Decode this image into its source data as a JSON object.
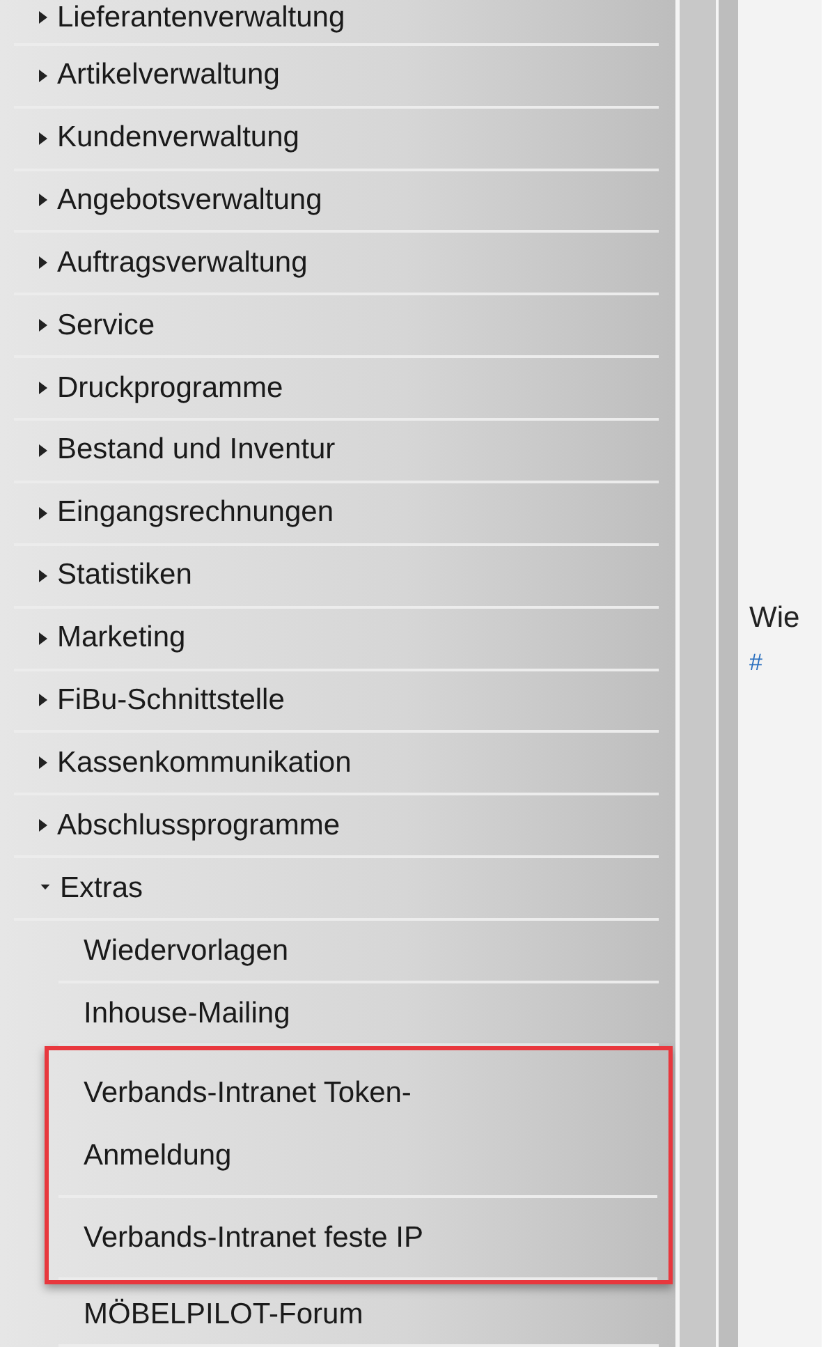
{
  "menu": {
    "items": [
      {
        "label": "Lieferantenverwaltung",
        "expanded": false
      },
      {
        "label": "Artikelverwaltung",
        "expanded": false
      },
      {
        "label": "Kundenverwaltung",
        "expanded": false
      },
      {
        "label": "Angebotsverwaltung",
        "expanded": false
      },
      {
        "label": "Auftragsverwaltung",
        "expanded": false
      },
      {
        "label": "Service",
        "expanded": false
      },
      {
        "label": "Druckprogramme",
        "expanded": false
      },
      {
        "label": "Bestand und Inventur",
        "expanded": false
      },
      {
        "label": "Eingangsrechnungen",
        "expanded": false
      },
      {
        "label": "Statistiken",
        "expanded": false
      },
      {
        "label": "Marketing",
        "expanded": false
      },
      {
        "label": "FiBu-Schnittstelle",
        "expanded": false
      },
      {
        "label": "Kassenkommunikation",
        "expanded": false
      },
      {
        "label": "Abschlussprogramme",
        "expanded": false
      },
      {
        "label": "Extras",
        "expanded": true,
        "children": [
          {
            "label": "Wiedervorlagen",
            "highlighted": false
          },
          {
            "label": "Inhouse-Mailing",
            "highlighted": false
          },
          {
            "label": "Verbands-Intranet Token-Anmeldung",
            "highlighted": true
          },
          {
            "label": "Verbands-Intranet feste IP",
            "highlighted": true
          },
          {
            "label": "MÖBELPILOT-Forum",
            "highlighted": false
          }
        ]
      }
    ]
  },
  "content_panel": {
    "heading": "Wie",
    "link": "#"
  }
}
